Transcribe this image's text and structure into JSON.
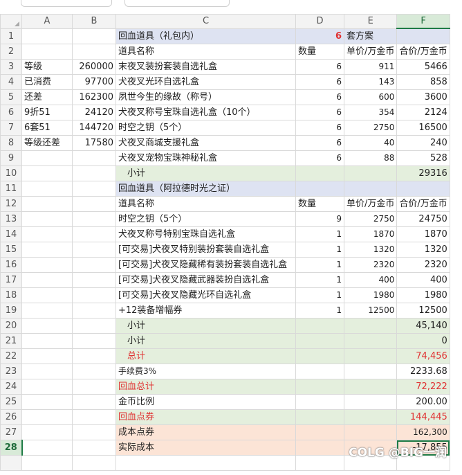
{
  "columns": [
    "",
    "A",
    "B",
    "C",
    "D",
    "E",
    "F"
  ],
  "rows": [
    {
      "n": "1",
      "a": "",
      "b": "",
      "c": "回血道具（礼包内）",
      "d": "6",
      "e": "套方案",
      "f": ""
    },
    {
      "n": "2",
      "a": "",
      "b": "",
      "c": "道具名称",
      "d": "数量",
      "e": "单价/万金币",
      "f": "合价/万金币"
    },
    {
      "n": "3",
      "a": "等级",
      "b": "260000",
      "c": "末夜叉装扮套装自选礼盒",
      "d": "6",
      "e": "911",
      "f": "5466"
    },
    {
      "n": "4",
      "a": "已消费",
      "b": "97700",
      "c": "犬夜叉光环自选礼盒",
      "d": "6",
      "e": "143",
      "f": "858"
    },
    {
      "n": "5",
      "a": "还差",
      "b": "162300",
      "c": "夙世今生的缘故（称号）",
      "d": "6",
      "e": "600",
      "f": "3600"
    },
    {
      "n": "6",
      "a": "9折51",
      "b": "24120",
      "c": "犬夜叉称号宝珠自选礼盒（10个）",
      "d": "6",
      "e": "354",
      "f": "2124"
    },
    {
      "n": "7",
      "a": "6套51",
      "b": "144720",
      "c": "时空之钥（5个）",
      "d": "6",
      "e": "2750",
      "f": "16500"
    },
    {
      "n": "8",
      "a": "等级还差",
      "b": "17580",
      "c": "犬夜叉商城支援礼盒",
      "d": "6",
      "e": "40",
      "f": "240"
    },
    {
      "n": "9",
      "a": "",
      "b": "",
      "c": "犬夜叉宠物宝珠神秘礼盒",
      "d": "6",
      "e": "88",
      "f": "528"
    },
    {
      "n": "10",
      "a": "",
      "b": "",
      "c": "小计",
      "d": "",
      "e": "",
      "f": "29316"
    },
    {
      "n": "11",
      "a": "",
      "b": "",
      "c": "回血道具（阿拉德时光之证）",
      "d": "",
      "e": "",
      "f": ""
    },
    {
      "n": "12",
      "a": "",
      "b": "",
      "c": "道具名称",
      "d": "数量",
      "e": "单价/万金币",
      "f": "合价/万金币"
    },
    {
      "n": "13",
      "a": "",
      "b": "",
      "c": "时空之钥（5个）",
      "d": "9",
      "e": "2750",
      "f": "24750"
    },
    {
      "n": "14",
      "a": "",
      "b": "",
      "c": "犬夜叉称号特别宝珠自选礼盒",
      "d": "1",
      "e": "1870",
      "f": "1870"
    },
    {
      "n": "15",
      "a": "",
      "b": "",
      "c": "[可交易]犬夜叉特别装扮套装自选礼盒",
      "d": "1",
      "e": "1320",
      "f": "1320"
    },
    {
      "n": "16",
      "a": "",
      "b": "",
      "c": "[可交易]犬夜叉隐藏稀有装扮套装自选礼盒",
      "d": "1",
      "e": "2320",
      "f": "2320"
    },
    {
      "n": "17",
      "a": "",
      "b": "",
      "c": "[可交易]犬夜叉隐藏武器装扮自选礼盒",
      "d": "1",
      "e": "400",
      "f": "400"
    },
    {
      "n": "18",
      "a": "",
      "b": "",
      "c": "[可交易]犬夜叉隐藏光环自选礼盒",
      "d": "1",
      "e": "1980",
      "f": "1980"
    },
    {
      "n": "19",
      "a": "",
      "b": "",
      "c": "+12装备增幅券",
      "d": "1",
      "e": "12500",
      "f": "12500"
    },
    {
      "n": "20",
      "a": "",
      "b": "",
      "c": "小计",
      "d": "",
      "e": "",
      "f": "45,140"
    },
    {
      "n": "21",
      "a": "",
      "b": "",
      "c": "小计",
      "d": "",
      "e": "",
      "f": "0"
    },
    {
      "n": "22",
      "a": "",
      "b": "",
      "c": "总计",
      "d": "",
      "e": "",
      "f": "74,456"
    },
    {
      "n": "23",
      "a": "",
      "b": "",
      "c": "手续费3%",
      "d": "",
      "e": "",
      "f": "2233.68"
    },
    {
      "n": "24",
      "a": "",
      "b": "",
      "c": "回血总计",
      "d": "",
      "e": "",
      "f": "72,222"
    },
    {
      "n": "25",
      "a": "",
      "b": "",
      "c": "金币比例",
      "d": "",
      "e": "",
      "f": "200.00"
    },
    {
      "n": "26",
      "a": "",
      "b": "",
      "c": "回血点券",
      "d": "",
      "e": "",
      "f": "144,445"
    },
    {
      "n": "27",
      "a": "",
      "b": "",
      "c": "成本点券",
      "d": "",
      "e": "",
      "f": "162,300"
    },
    {
      "n": "28",
      "a": "",
      "b": "",
      "c": "实际成本",
      "d": "",
      "e": "",
      "f": "-17,855"
    }
  ],
  "watermark": "COLG @BIG一润",
  "colors": {
    "header_blue": "#dee3f2",
    "subtotal_green": "#e4efdd",
    "cost_peach": "#fce4d6",
    "accent_red": "#e03131",
    "select_green": "#1e7b45"
  }
}
